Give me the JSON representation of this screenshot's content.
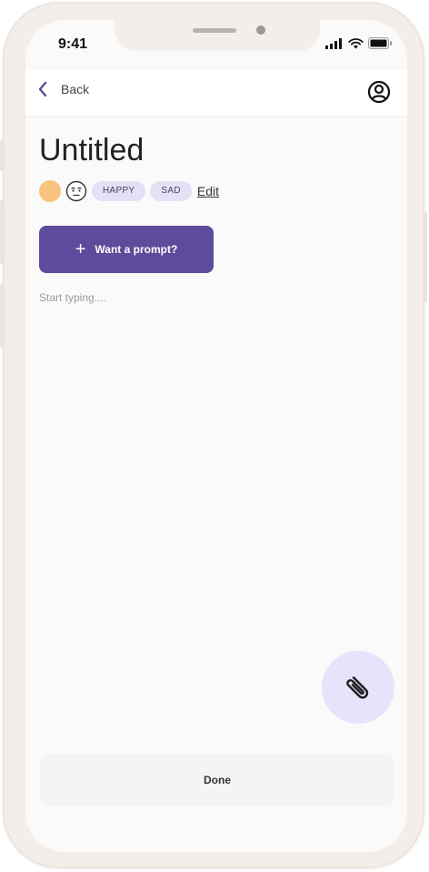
{
  "status_bar": {
    "time": "9:41",
    "icons": [
      "signal-icon",
      "wifi-icon",
      "battery-icon"
    ]
  },
  "nav": {
    "back_label": "Back",
    "back_icon": "chevron-left-icon",
    "account_icon": "user-circle-icon"
  },
  "entry": {
    "title": "Untitled",
    "mood_color": "#f7c37e",
    "mood_icon": "neutral-face-icon",
    "tags": [
      "HAPPY",
      "SAD"
    ],
    "edit_label": "Edit"
  },
  "prompt_button": {
    "label": "Want a prompt?",
    "icon": "plus-icon"
  },
  "editor": {
    "placeholder": "Start typing...."
  },
  "attach_button": {
    "icon": "paperclip-icon"
  },
  "done_button": {
    "label": "Done"
  },
  "colors": {
    "accent": "#5e4b9b",
    "chip_bg": "#e6e0f7",
    "fab_bg": "#e8e2fb",
    "frame": "#f3eeea"
  }
}
